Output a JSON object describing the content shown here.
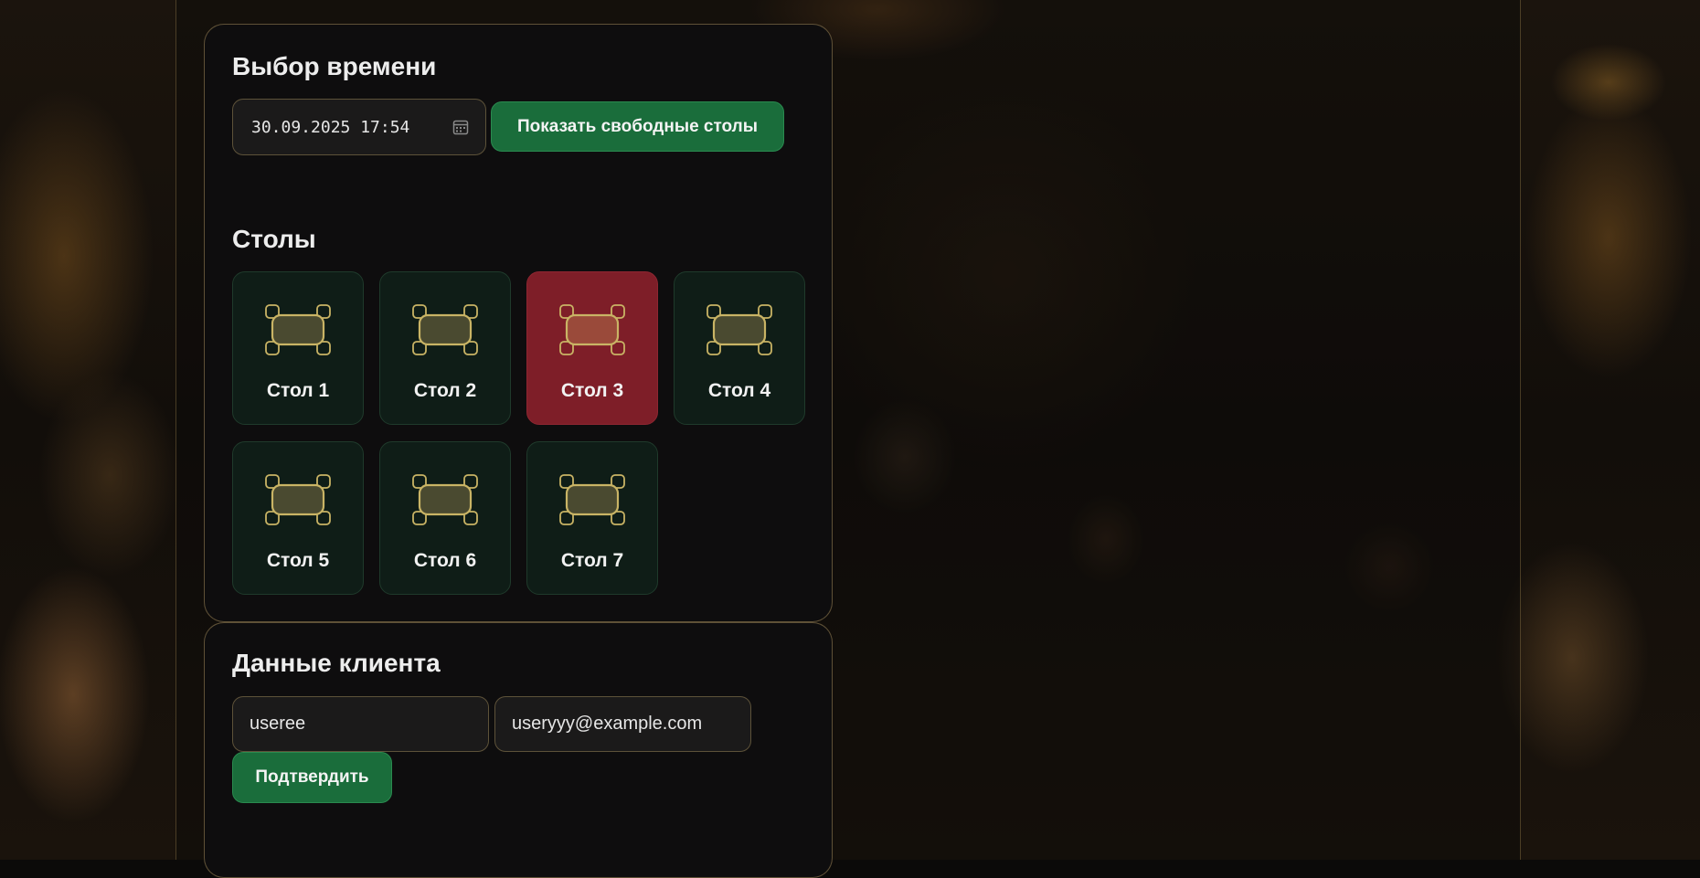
{
  "time_section": {
    "title": "Выбор времени",
    "datetime_value": "30.09.2025 17:54",
    "show_button_label": "Показать свободные столы"
  },
  "tables_section": {
    "title": "Столы",
    "tables": [
      {
        "label": "Стол 1",
        "status": "free"
      },
      {
        "label": "Стол 2",
        "status": "free"
      },
      {
        "label": "Стол 3",
        "status": "busy"
      },
      {
        "label": "Стол 4",
        "status": "free"
      },
      {
        "label": "Стол 5",
        "status": "free"
      },
      {
        "label": "Стол 6",
        "status": "free"
      },
      {
        "label": "Стол 7",
        "status": "free"
      }
    ]
  },
  "client_section": {
    "title": "Данные клиента",
    "name_value": "useree",
    "email_value": "useryyy@example.com",
    "confirm_button_label": "Подтвердить"
  },
  "colors": {
    "accent_green": "#1a6d3b",
    "busy_red": "#7e1e28",
    "free_tile": "#0f1d17",
    "gold_outline": "#c9b465"
  },
  "icons": {
    "table_icon": "table-with-chairs-icon",
    "calendar_icon": "calendar-icon"
  }
}
